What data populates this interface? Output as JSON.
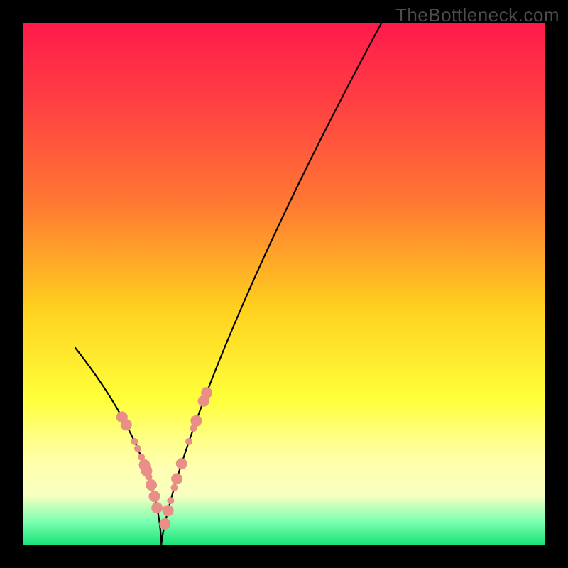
{
  "watermark": "TheBottleneck.com",
  "chart_data": {
    "type": "line",
    "title": "",
    "xlabel": "",
    "ylabel": "",
    "xlim": [
      0,
      100
    ],
    "ylim": [
      0,
      100
    ],
    "gradient_stops": [
      {
        "offset": 0.0,
        "color": "#ff1a4b"
      },
      {
        "offset": 0.15,
        "color": "#ff3f43"
      },
      {
        "offset": 0.35,
        "color": "#ff7a32"
      },
      {
        "offset": 0.55,
        "color": "#ffd21f"
      },
      {
        "offset": 0.72,
        "color": "#ffff3a"
      },
      {
        "offset": 0.8,
        "color": "#ffff8a"
      },
      {
        "offset": 0.85,
        "color": "#ffffb0"
      },
      {
        "offset": 0.905,
        "color": "#f7ffc0"
      },
      {
        "offset": 0.955,
        "color": "#7bffb0"
      },
      {
        "offset": 1.0,
        "color": "#17e277"
      }
    ],
    "curves": {
      "x0": 26.5,
      "left": {
        "x_top": 10.0,
        "y_top": 100.0,
        "k": 8.1,
        "p": 0.55
      },
      "right": {
        "x_top": 100.0,
        "y_top": 85.0,
        "k": 5.4,
        "p": 0.78
      }
    },
    "markers": {
      "color": "#e98f87",
      "radius_major": 8,
      "radius_minor": 5,
      "left_x": [
        19.0,
        19.8,
        21.4,
        22.0,
        22.7,
        23.3,
        23.7,
        24.1,
        24.6,
        25.2,
        25.7
      ],
      "right_x": [
        27.2,
        27.8,
        28.3,
        29.0,
        29.5,
        30.4,
        31.8,
        32.7,
        33.2,
        34.6,
        35.2
      ],
      "left_major_idx": [
        0,
        1,
        5,
        6,
        8,
        9,
        10
      ],
      "right_major_idx": [
        0,
        1,
        4,
        5,
        8,
        9,
        10
      ]
    }
  }
}
